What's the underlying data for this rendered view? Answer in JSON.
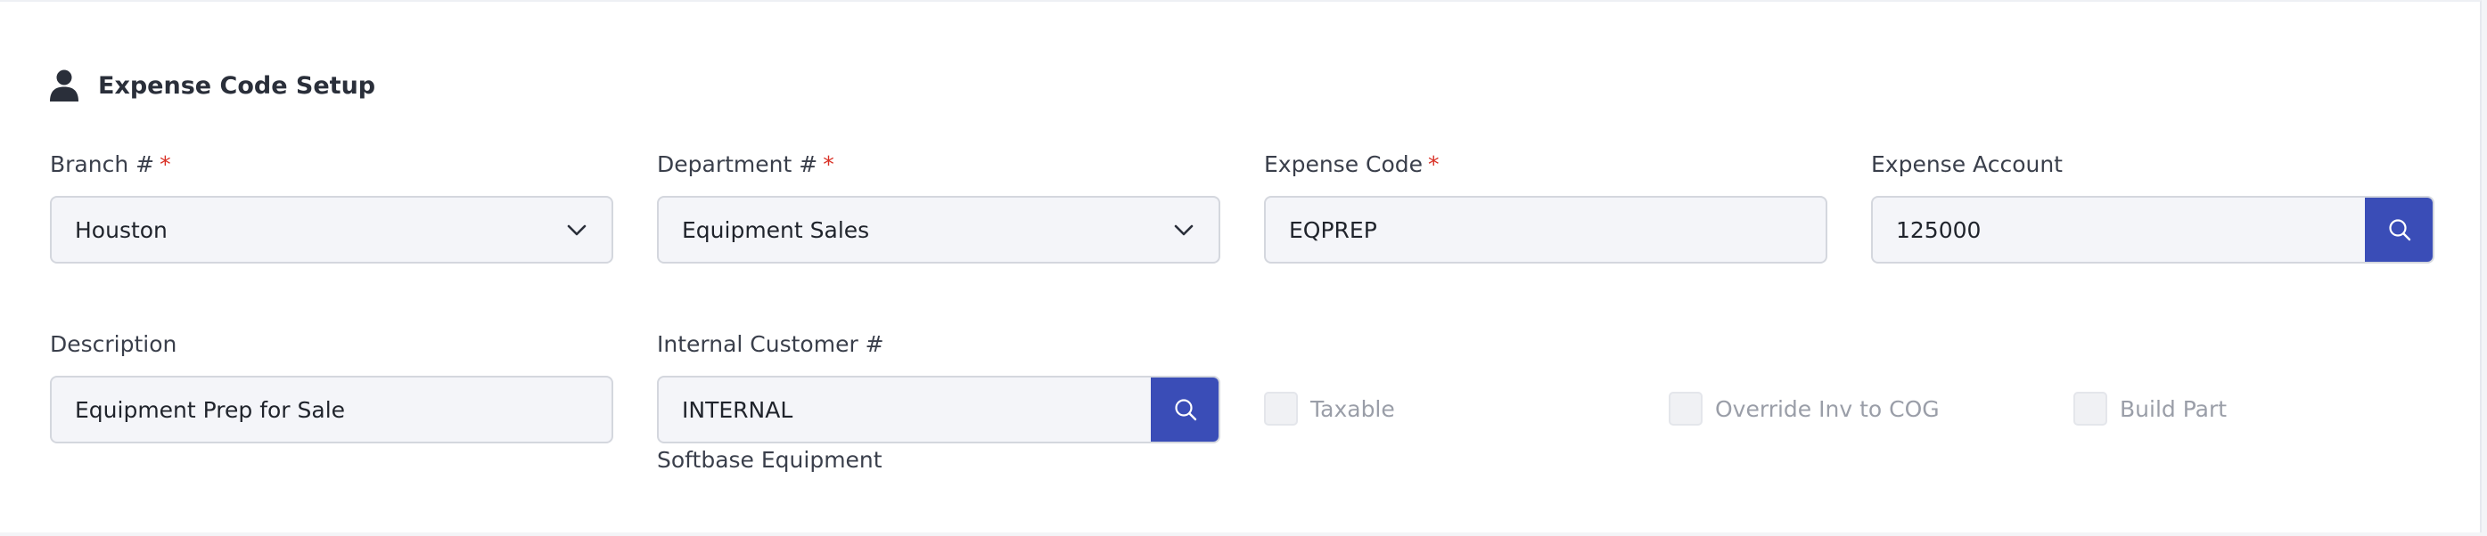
{
  "header": {
    "title": "Expense Code Setup",
    "icon": "user-icon"
  },
  "branch": {
    "label": "Branch #",
    "required_mark": "*",
    "value": "Houston"
  },
  "department": {
    "label": "Department #",
    "required_mark": "*",
    "value": "Equipment Sales"
  },
  "expense_code": {
    "label": "Expense Code",
    "required_mark": "*",
    "value": "EQPREP"
  },
  "expense_account": {
    "label": "Expense Account",
    "value": "125000"
  },
  "description": {
    "label": "Description",
    "value": "Equipment Prep for Sale"
  },
  "internal_customer": {
    "label": "Internal Customer #",
    "value": "INTERNAL",
    "customer_name": "Softbase Equipment"
  },
  "checkboxes": {
    "taxable": "Taxable",
    "override_inv_to_cog": "Override Inv to COG",
    "build_part": "Build Part"
  },
  "colors": {
    "accent": "#3a4db7",
    "required": "#d93025"
  }
}
